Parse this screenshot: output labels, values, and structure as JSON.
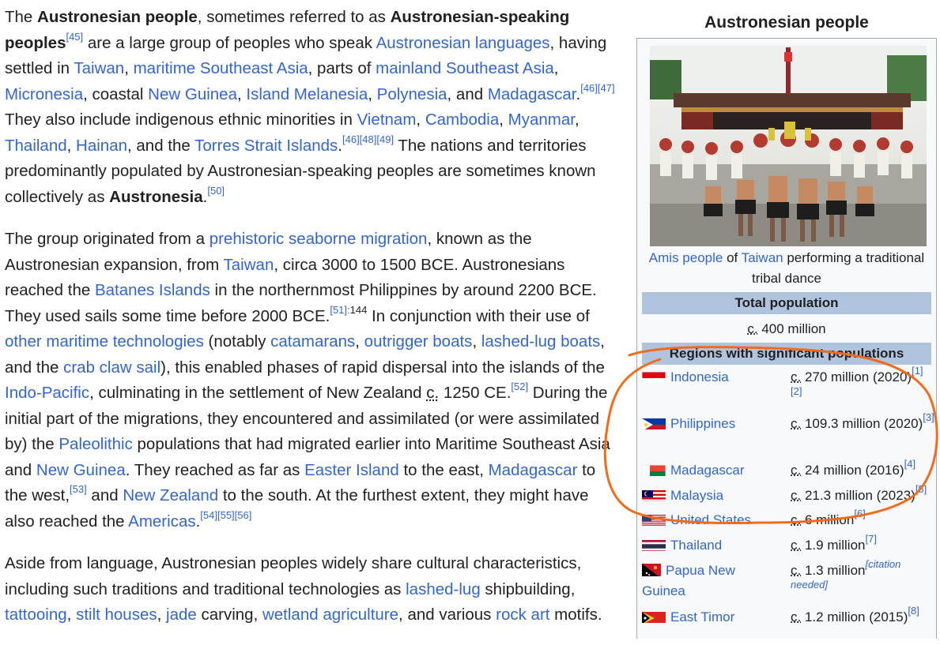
{
  "article": {
    "p1": {
      "t1": "The ",
      "b1": "Austronesian people",
      "t2": ", sometimes referred to as ",
      "b2": "Austronesian-speaking peoples",
      "r45": "[45]",
      "t3": " are a large group of peoples who speak ",
      "l_austronesian_languages": "Austronesian languages",
      "t4": ", having settled in ",
      "l_taiwan": "Taiwan",
      "c1": ", ",
      "l_maritime_sea": "maritime Southeast Asia",
      "t5": ", parts of ",
      "l_mainland_sea": "mainland Southeast Asia",
      "c2": ", ",
      "l_micronesia": "Micronesia",
      "t6": ", coastal ",
      "l_new_guinea": "New Guinea",
      "c3": ", ",
      "l_island_melanesia": "Island Melanesia",
      "c4": ", ",
      "l_polynesia": "Polynesia",
      "t7": ", and ",
      "l_madagascar": "Madagascar",
      "t8": ".",
      "r46": "[46]",
      "r47": "[47]",
      "t9": " They also include indigenous ethnic minorities in ",
      "l_vietnam": "Vietnam",
      "c5": ", ",
      "l_cambodia": "Cambodia",
      "c6": ", ",
      "l_myanmar": "Myanmar",
      "c7": ", ",
      "l_thailand": "Thailand",
      "c8": ", ",
      "l_hainan": "Hainan",
      "t10": ", and the ",
      "l_torres": "Torres Strait Islands",
      "t11": ".",
      "r46b": "[46]",
      "r48": "[48]",
      "r49": "[49]",
      "t12": " The nations and territories predominantly populated by Austronesian-speaking peoples are sometimes known collectively as ",
      "b3": "Austronesia",
      "t13": ".",
      "r50": "[50]"
    },
    "p2": {
      "t1": "The group originated from a ",
      "l_prehistoric": "prehistoric seaborne migration",
      "t2": ", known as the Austronesian expansion, from ",
      "l_taiwan": "Taiwan",
      "t3": ", circa 3000 to 1500 BCE. Austronesians reached the ",
      "l_batanes": "Batanes Islands",
      "t4": " in the northernmost Philippines by around 2200 BCE. They used sails some time before 2000 BCE.",
      "r51": "[51]:",
      "r51p": "144",
      "t5": " In conjunction with their use of ",
      "l_other_maritime": "other maritime technologies",
      "t6": " (notably ",
      "l_catamarans": "catamarans",
      "c1": ", ",
      "l_outrigger": "outrigger boats",
      "c2": ", ",
      "l_lashed": "lashed-lug boats",
      "t7": ", and the ",
      "l_crab": "crab claw sail",
      "t8": "), this enabled phases of rapid dispersal into the islands of the ",
      "l_indo_pacific": "Indo-Pacific",
      "t9": ", culminating in the settlement of New Zealand ",
      "circa": "c.",
      "t10": " 1250 CE.",
      "r52": "[52]",
      "t11": " During the initial part of the migrations, they encountered and assimilated (or were assimilated by) the ",
      "l_paleolithic": "Paleolithic",
      "t12": " populations that had migrated earlier into Maritime Southeast Asia and ",
      "l_new_guinea": "New Guinea",
      "t13": ". They reached as far as ",
      "l_easter": "Easter Island",
      "t14": " to the east, ",
      "l_madagascar": "Madagascar",
      "t15": " to the west,",
      "r53": "[53]",
      "t16": " and ",
      "l_new_zealand": "New Zealand",
      "t17": " to the south. At the furthest extent, they might have also reached the ",
      "l_americas": "Americas",
      "t18": ".",
      "r54": "[54]",
      "r55": "[55]",
      "r56": "[56]"
    },
    "p3": {
      "t1": "Aside from language, Austronesian peoples widely share cultural characteristics, including such traditions and traditional technologies as ",
      "l_lashed": "lashed-lug",
      "t2": " shipbuilding, ",
      "l_tattooing": "tattooing",
      "c1": ", ",
      "l_stilt": "stilt houses",
      "c2": ", ",
      "l_jade": "jade",
      "t3": " carving, ",
      "l_wetland": "wetland agriculture",
      "t4": ", and various ",
      "l_rock": "rock art",
      "t5": " motifs."
    }
  },
  "infobox": {
    "title": "Austronesian people",
    "caption": {
      "l_amis": "Amis people",
      "t1": " of ",
      "l_taiwan": "Taiwan",
      "t2": " performing a traditional tribal dance"
    },
    "total_population_header": "Total population",
    "total_population": {
      "circa": "c.",
      "value": " 400 million"
    },
    "regions_header": "Regions with significant populations",
    "regions": [
      {
        "country": "Indonesia",
        "circa": "c.",
        "value": " 270 million (2020)",
        "refs": [
          "[1]",
          "[2]"
        ],
        "flag": "indonesia"
      },
      {
        "country": "Philippines",
        "circa": "c.",
        "value": " 109.3 million (2020)",
        "refs": [
          "[3]"
        ],
        "flag": "philippines"
      },
      {
        "country": "Madagascar",
        "circa": "c.",
        "value": " 24 million (2016)",
        "refs": [
          "[4]"
        ],
        "flag": "madagascar"
      },
      {
        "country": "Malaysia",
        "circa": "c.",
        "value": " 21.3 million (2023)",
        "refs": [
          "[5]"
        ],
        "flag": "malaysia"
      },
      {
        "country": "United States",
        "circa": "c.",
        "value": " 6 million",
        "refs": [
          "[6]"
        ],
        "flag": "usa"
      },
      {
        "country": "Thailand",
        "circa": "c.",
        "value": " 1.9 million",
        "refs": [
          "[7]"
        ],
        "flag": "thailand"
      },
      {
        "country": "Papua New Guinea",
        "circa": "c.",
        "value": " 1.3 million",
        "refs": [
          "[citation needed]"
        ],
        "flag": "png"
      },
      {
        "country": "East Timor",
        "circa": "c.",
        "value": " 1.2 million (2015)",
        "refs": [
          "[8]"
        ],
        "flag": "east-timor"
      }
    ]
  },
  "colors": {
    "link": "#3366cc",
    "text": "#202122",
    "infobox_header": "#b0c4de",
    "annotation": "#f26b1d"
  }
}
